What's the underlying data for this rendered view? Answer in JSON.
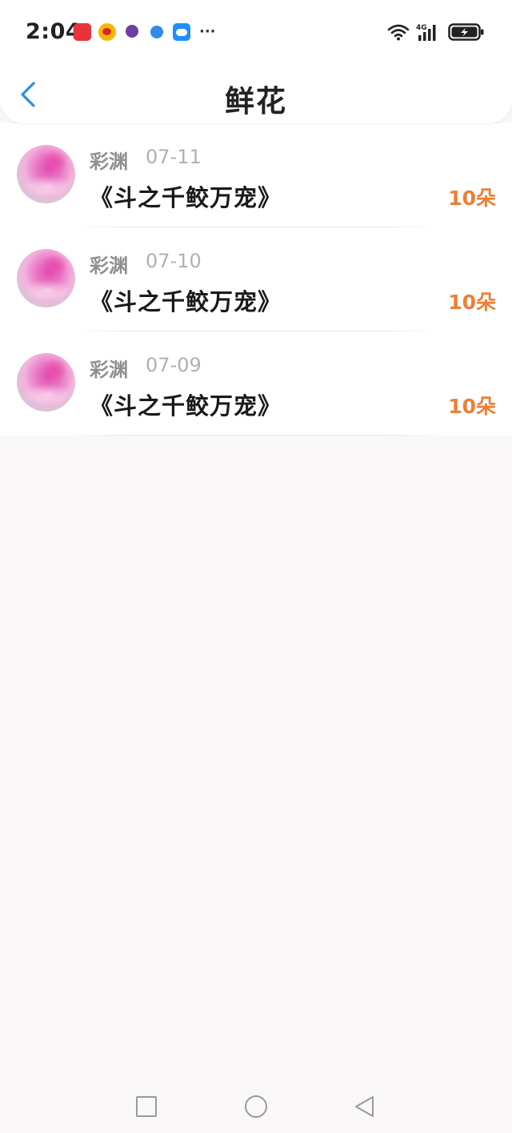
{
  "status_bar": {
    "time": "2:04",
    "notification_apps": [
      "huawei-appgallery-icon",
      "weibo-icon",
      "game-icon",
      "link-icon",
      "weather-icon"
    ],
    "more_indicator": "···",
    "network_type": "4G"
  },
  "header": {
    "title": "鲜花",
    "back_icon": "chevron-left-icon",
    "accent_color": "#2e8be8"
  },
  "records": [
    {
      "user": "彩渊",
      "date": "07-11",
      "book": "《斗之千鲛万宠》",
      "amount": "10朵"
    },
    {
      "user": "彩渊",
      "date": "07-10",
      "book": "《斗之千鲛万宠》",
      "amount": "10朵"
    },
    {
      "user": "彩渊",
      "date": "07-09",
      "book": "《斗之千鲛万宠》",
      "amount": "10朵"
    }
  ],
  "colors": {
    "amount": "#ec7f34",
    "page_background": "#f9f7f8"
  },
  "system_nav": [
    "square-icon",
    "circle-icon",
    "triangle-back-icon"
  ]
}
